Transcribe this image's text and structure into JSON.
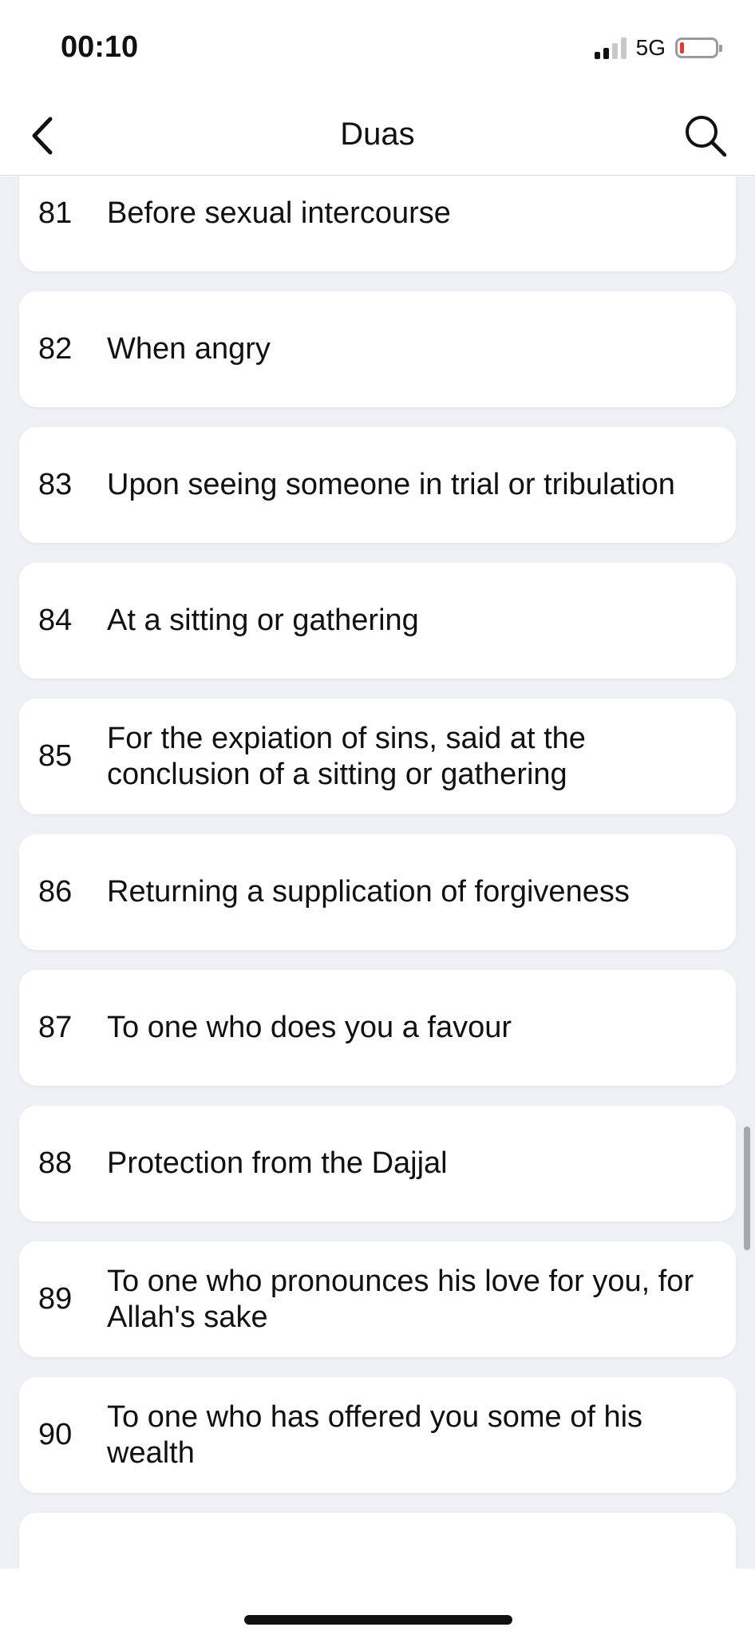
{
  "status_bar": {
    "time": "00:10",
    "network": "5G",
    "battery_level_percent": 5,
    "battery_color": "#e53935",
    "signal_icon": "cellular-signal-icon",
    "battery_icon": "battery-low-icon"
  },
  "nav": {
    "title": "Duas",
    "back_icon": "chevron-left-icon",
    "search_icon": "search-icon"
  },
  "duas": [
    {
      "number": "81",
      "title": "Before sexual intercourse"
    },
    {
      "number": "82",
      "title": "When angry"
    },
    {
      "number": "83",
      "title": "Upon seeing someone in trial or tribulation"
    },
    {
      "number": "84",
      "title": "At a sitting or gathering"
    },
    {
      "number": "85",
      "title": "For the expiation of sins, said at the conclusion of a sitting or gathering"
    },
    {
      "number": "86",
      "title": "Returning a supplication of forgiveness"
    },
    {
      "number": "87",
      "title": "To one who does you a favour"
    },
    {
      "number": "88",
      "title": "Protection from the Dajjal"
    },
    {
      "number": "89",
      "title": "To one who pronounces his love for you, for Allah's sake"
    },
    {
      "number": "90",
      "title": "To one who has offered you some of his wealth"
    }
  ],
  "colors": {
    "background": "#eef0f5",
    "card": "#ffffff",
    "text": "#111111"
  }
}
